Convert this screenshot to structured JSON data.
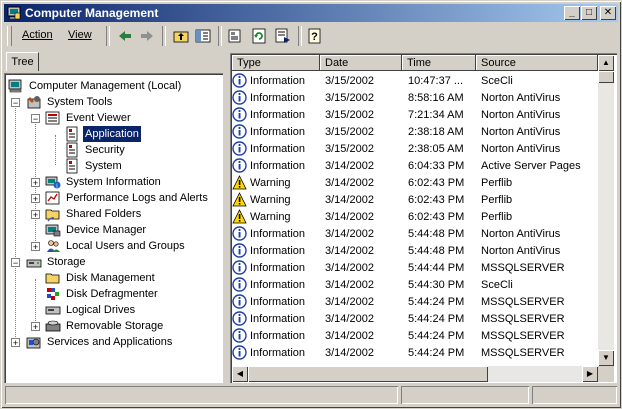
{
  "window": {
    "title": "Computer Management"
  },
  "title_buttons": {
    "minimize": "_",
    "maximize": "□",
    "close": "✕"
  },
  "menu": {
    "action_label": "Action",
    "view_label": "View"
  },
  "toolbar_icons": [
    "back-icon",
    "forward-icon",
    "up-folder-icon",
    "show-hide-tree-icon",
    "properties-icon",
    "refresh-icon",
    "export-list-icon",
    "help-icon"
  ],
  "tab": {
    "label": "Tree"
  },
  "tree": {
    "root": "Computer Management (Local)",
    "system_tools": "System Tools",
    "event_viewer": "Event Viewer",
    "application": "Application",
    "security": "Security",
    "system": "System",
    "system_information": "System Information",
    "performance_logs": "Performance Logs and Alerts",
    "shared_folders": "Shared Folders",
    "device_manager": "Device Manager",
    "local_users": "Local Users and Groups",
    "storage": "Storage",
    "disk_management": "Disk Management",
    "disk_defragmenter": "Disk Defragmenter",
    "logical_drives": "Logical Drives",
    "removable_storage": "Removable Storage",
    "services_apps": "Services and Applications"
  },
  "list": {
    "columns": [
      "Type",
      "Date",
      "Time",
      "Source"
    ],
    "rows": [
      {
        "type": "Information",
        "date": "3/15/2002",
        "time": "10:47:37 ...",
        "source": "SceCli"
      },
      {
        "type": "Information",
        "date": "3/15/2002",
        "time": "8:58:16 AM",
        "source": "Norton AntiVirus"
      },
      {
        "type": "Information",
        "date": "3/15/2002",
        "time": "7:21:34 AM",
        "source": "Norton AntiVirus"
      },
      {
        "type": "Information",
        "date": "3/15/2002",
        "time": "2:38:18 AM",
        "source": "Norton AntiVirus"
      },
      {
        "type": "Information",
        "date": "3/15/2002",
        "time": "2:38:05 AM",
        "source": "Norton AntiVirus"
      },
      {
        "type": "Information",
        "date": "3/14/2002",
        "time": "6:04:33 PM",
        "source": "Active Server Pages"
      },
      {
        "type": "Warning",
        "date": "3/14/2002",
        "time": "6:02:43 PM",
        "source": "Perflib"
      },
      {
        "type": "Warning",
        "date": "3/14/2002",
        "time": "6:02:43 PM",
        "source": "Perflib"
      },
      {
        "type": "Warning",
        "date": "3/14/2002",
        "time": "6:02:43 PM",
        "source": "Perflib"
      },
      {
        "type": "Information",
        "date": "3/14/2002",
        "time": "5:44:48 PM",
        "source": "Norton AntiVirus"
      },
      {
        "type": "Information",
        "date": "3/14/2002",
        "time": "5:44:48 PM",
        "source": "Norton AntiVirus"
      },
      {
        "type": "Information",
        "date": "3/14/2002",
        "time": "5:44:44 PM",
        "source": "MSSQLSERVER"
      },
      {
        "type": "Information",
        "date": "3/14/2002",
        "time": "5:44:30 PM",
        "source": "SceCli"
      },
      {
        "type": "Information",
        "date": "3/14/2002",
        "time": "5:44:24 PM",
        "source": "MSSQLSERVER"
      },
      {
        "type": "Information",
        "date": "3/14/2002",
        "time": "5:44:24 PM",
        "source": "MSSQLSERVER"
      },
      {
        "type": "Information",
        "date": "3/14/2002",
        "time": "5:44:24 PM",
        "source": "MSSQLSERVER"
      },
      {
        "type": "Information",
        "date": "3/14/2002",
        "time": "5:44:24 PM",
        "source": "MSSQLSERVER"
      }
    ]
  },
  "colors": {
    "title_start": "#0a246a",
    "title_end": "#a6caf0",
    "selection": "#0a246a",
    "face": "#d4d0c8"
  }
}
